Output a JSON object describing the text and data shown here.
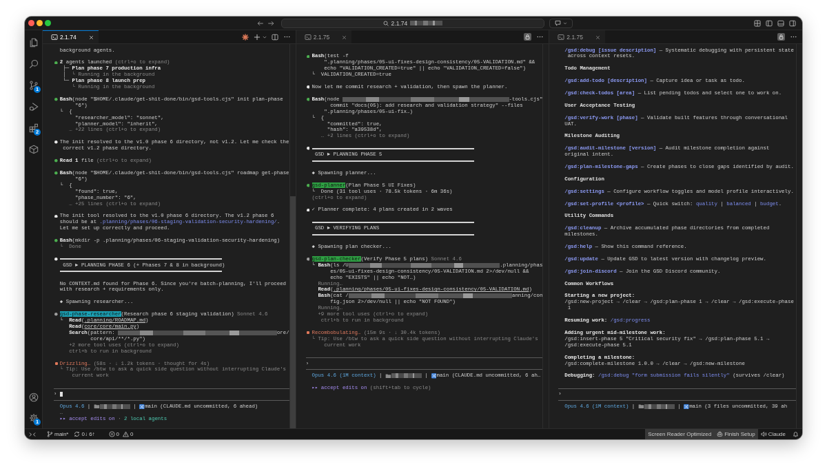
{
  "title_bar": {
    "command_center": {
      "text": "2.1.74",
      "redacted": true
    }
  },
  "activity_bar": {
    "top": [
      {
        "kind": "explorer"
      },
      {
        "kind": "search"
      },
      {
        "kind": "scm",
        "badge": "1"
      },
      {
        "kind": "debug"
      },
      {
        "kind": "extensions",
        "badge": "2"
      },
      {
        "kind": "containers"
      }
    ],
    "bottom": [
      {
        "kind": "account"
      },
      {
        "kind": "settings",
        "badge": "1"
      }
    ]
  },
  "panes": [
    {
      "tab": {
        "label": "2.1.74",
        "focused": true
      },
      "actions": [
        {
          "kind": "spark"
        },
        {
          "kind": "new"
        },
        {
          "kind": "dropdown"
        },
        {
          "kind": "split"
        },
        {
          "kind": "more"
        }
      ],
      "scroll_thumb": true,
      "blocks": [
        {
          "kind": "continuation",
          "paras": [
            {
              "lines": [
                [
                  "background agents."
                ]
              ]
            }
          ]
        },
        {
          "kind": "entry",
          "bullet": {
            "kind": "dot",
            "color": "#4caf50"
          },
          "paras": [
            {
              "lines": [
                [
                  {
                    "text": "2",
                    "kind": "bold"
                  },
                  " agents launched ",
                  {
                    "text": "(ctrl+o to expand)",
                    "kind": "dim"
                  }
                ]
              ]
            },
            {
              "lines": [
                [
                  " ├─ ",
                  {
                    "text": "Plan phase 7 production infra",
                    "kind": "bold"
                  }
                ],
                [
                  " │  ",
                  {
                    "text": "└ Running in the background",
                    "kind": "dim"
                  }
                ],
                [
                  " └─ ",
                  {
                    "text": "Plan phase 8 launch prep",
                    "kind": "bold"
                  }
                ],
                [
                  {
                    "text": "    └ Running in the background",
                    "kind": "dim"
                  }
                ]
              ]
            }
          ]
        },
        {
          "kind": "entry",
          "bullet": {
            "kind": "dot",
            "color": "#4caf50"
          },
          "paras": [
            {
              "lines": [
                [
                  {
                    "text": "Bash",
                    "kind": "bold"
                  },
                  "(node \"$HOME/.claude/get-shit-done/bin/gsd-tools.cjs\" init plan-phase"
                ],
                [
                  "     \"6\")"
                ]
              ]
            },
            {
              "lines": [
                [
                  "└  {"
                ],
                [
                  "     \"researcher_model\": \"sonnet\","
                ],
                [
                  "     \"planner_model\": \"inherit\","
                ],
                [
                  {
                    "text": "   … +22 lines (ctrl+o to expand)",
                    "kind": "dim"
                  }
                ]
              ]
            }
          ]
        },
        {
          "kind": "entry",
          "bullet": {
            "kind": "dot",
            "color": "#e6e6e6"
          },
          "paras": [
            {
              "lines": [
                [
                  "The init resolved to the v1.0 phase 6 directory, not v1.2. Let me check the"
                ],
                [
                  " correct v1.2 phase directory."
                ]
              ]
            }
          ]
        },
        {
          "kind": "entry",
          "bullet": {
            "kind": "dot",
            "color": "#4caf50"
          },
          "paras": [
            {
              "lines": [
                [
                  {
                    "text": "Read 1",
                    "kind": "bold"
                  },
                  " file ",
                  {
                    "text": "(ctrl+o to expand)",
                    "kind": "dim"
                  }
                ]
              ]
            }
          ]
        },
        {
          "kind": "entry",
          "bullet": {
            "kind": "dot",
            "color": "#4caf50"
          },
          "paras": [
            {
              "lines": [
                [
                  {
                    "text": "Bash",
                    "kind": "bold"
                  },
                  "(node \"$HOME/.claude/get-shit-done/bin/gsd-tools.cjs\" roadmap get-phase"
                ],
                [
                  "     \"6\")"
                ]
              ]
            },
            {
              "lines": [
                [
                  "└  {"
                ],
                [
                  "     \"found\": true,"
                ],
                [
                  "     \"phase_number\": \"6\","
                ],
                [
                  {
                    "text": "   … +25 lines (ctrl+o to expand)",
                    "kind": "dim"
                  }
                ]
              ]
            }
          ]
        },
        {
          "kind": "entry",
          "bullet": {
            "kind": "dot",
            "color": "#e6e6e6"
          },
          "paras": [
            {
              "lines": [
                [
                  "The init tool resolved to the v1.0 phase 6 directory. The v1.2 phase 6"
                ],
                [
                  "should be at ",
                  {
                    "text": ".planning/phases/06-staging-validation-security-hardening/",
                    "kind": "link"
                  },
                  "."
                ],
                [
                  "Let me set up correctly and proceed."
                ]
              ]
            }
          ]
        },
        {
          "kind": "entry",
          "bullet": {
            "kind": "dot",
            "color": "#4caf50"
          },
          "paras": [
            {
              "lines": [
                [
                  {
                    "text": "Bash",
                    "kind": "bold"
                  },
                  "(mkdir -p .planning/phases/06-staging-validation-security-hardening)"
                ]
              ]
            },
            {
              "lines": [
                [
                  {
                    "text": "└  Done",
                    "kind": "dim"
                  }
                ]
              ]
            }
          ]
        },
        {
          "kind": "entry",
          "bullet": {
            "kind": "dot",
            "color": "#e6e6e6"
          },
          "paras": [
            {
              "kind": "banner",
              "lines": [
                [
                  "GSD ► PLANNING PHASE 6 (+ Phases 7 & 8 in background)"
                ]
              ]
            }
          ]
        },
        {
          "kind": "entry",
          "paras": [
            {
              "lines": [
                [
                  "No CONTEXT.md found for Phase 6. Since you're batch-planning, I'll proceed"
                ],
                [
                  "with research + requirements only."
                ]
              ]
            }
          ]
        },
        {
          "kind": "entry",
          "paras": [
            {
              "lines": [
                [
                  "◆ Spawning researcher..."
                ]
              ]
            }
          ]
        },
        {
          "kind": "entry",
          "bullet": {
            "kind": "dot",
            "color": "#9e9e9e"
          },
          "paras": [
            {
              "lines": [
                [
                  {
                    "text": "gsd-phase-researcher",
                    "kind": "agent",
                    "color": "#1ba1b5"
                  },
                  "(Research phase 6 staging validation) ",
                  {
                    "text": "Sonnet 4.6",
                    "kind": "dim"
                  }
                ]
              ]
            },
            {
              "lines": [
                [
                  "└  ",
                  {
                    "text": "Read",
                    "kind": "bold"
                  },
                  "(",
                  {
                    "text": ".planning/ROADMAP.md",
                    "kind": "path"
                  },
                  ")"
                ],
                [
                  {
                    "text": "   Read",
                    "kind": "bold"
                  },
                  "(",
                  {
                    "text": "core/core/main.py",
                    "kind": "path"
                  },
                  ")"
                ],
                [
                  {
                    "text": "   Search",
                    "kind": "bold"
                  },
                  "(pattern: ",
                  {
                    "kind": "redaction-fill"
                  },
                  "ore/"
                ],
                [
                  "          core/api/**/*.py\")"
                ],
                [
                  {
                    "text": "   +2 more tool uses (ctrl+o to expand)",
                    "kind": "dim"
                  }
                ],
                [
                  {
                    "text": "   ctrl+b to run in background",
                    "kind": "dim"
                  }
                ]
              ]
            }
          ]
        },
        {
          "kind": "entry",
          "bullet": {
            "kind": "spinner",
            "color": "#e0785a"
          },
          "paras": [
            {
              "lines": [
                [
                  {
                    "text": "Drizzling…",
                    "kind": "busy"
                  },
                  {
                    "text": " (58s · ↓ 1.2k tokens · thought for 4s)",
                    "kind": "dim"
                  }
                ]
              ]
            },
            {
              "lines": [
                [
                  {
                    "text": "└ Tip: Use /btw to ask a quick side question without interrupting Claude's",
                    "kind": "dim"
                  }
                ],
                [
                  {
                    "text": "    current work",
                    "kind": "dim"
                  }
                ]
              ]
            }
          ]
        }
      ],
      "input": {
        "prompt": "›",
        "cursor": true
      },
      "footer": [
        {
          "kind": "continuation",
          "paras": [
            {
              "lines": [
                [
                  {
                    "text": "Opus 4.6",
                    "kind": "model"
                  },
                  " | ",
                  {
                    "kind": "folder"
                  },
                  {
                    "kind": "redaction"
                  },
                  " | ",
                  {
                    "kind": "branch"
                  },
                  "main (CLAUDE.md uncommitted, 6 ahead)"
                ]
              ]
            },
            {
              "lines": [
                [
                  {
                    "text": "…",
                    "kind": "dim"
                  }
                ]
              ]
            },
            {
              "lines": [
                [
                  {
                    "text": "▸▸ accept edits on",
                    "kind": "mode"
                  },
                  {
                    "text": " · ",
                    "kind": "dim"
                  },
                  {
                    "text": "2 local agents",
                    "kind": "ok"
                  }
                ]
              ]
            }
          ]
        }
      ]
    },
    {
      "tab": {
        "label": "2.1.75",
        "focused": false
      },
      "actions": [
        {
          "kind": "lock"
        },
        {
          "kind": "more"
        }
      ],
      "locked": true,
      "blocks": [
        {
          "kind": "entry",
          "bullet": {
            "kind": "dot",
            "color": "#4caf50"
          },
          "paras": [
            {
              "lines": [
                [
                  {
                    "text": "Bash",
                    "kind": "bold"
                  },
                  "(test -f"
                ],
                [
                  "    \".planning/phases/05-ui-fixes-design-consistency/05-VALIDATION.md\" &&"
                ],
                [
                  "    echo \"VALIDATION_CREATED=true\" || echo \"VALIDATION_CREATED=false\")"
                ]
              ]
            },
            {
              "lines": [
                [
                  "└  VALIDATION_CREATED=true"
                ]
              ]
            }
          ]
        },
        {
          "kind": "entry",
          "bullet": {
            "kind": "dot",
            "color": "#e6e6e6"
          },
          "paras": [
            {
              "lines": [
                [
                  "Now let me commit research + validation, then spawn the planner."
                ]
              ]
            }
          ]
        },
        {
          "kind": "entry",
          "bullet": {
            "kind": "dot",
            "color": "#4caf50"
          },
          "paras": [
            {
              "lines": [
                [
                  {
                    "text": "Bash",
                    "kind": "bold"
                  },
                  "(node ",
                  {
                    "kind": "redaction-fill"
                  },
                  "-tools.cjs\""
                ],
                [
                  "      commit \"docs(05): add research and validation strategy\" --files"
                ],
                [
                  "    \".planning/phases/05-ui-fix…)"
                ]
              ]
            },
            {
              "lines": [
                [
                  "└  {"
                ],
                [
                  "     \"committed\": true,"
                ],
                [
                  "     \"hash\": \"a39538d\","
                ],
                [
                  {
                    "text": "   … +2 lines (ctrl+o to expand)",
                    "kind": "dim"
                  }
                ]
              ]
            }
          ]
        },
        {
          "kind": "entry",
          "bullet": {
            "kind": "dot",
            "color": "#e6e6e6"
          },
          "paras": [
            {
              "kind": "banner",
              "lines": [
                [
                  "GSD ► PLANNING PHASE 5"
                ]
              ]
            }
          ]
        },
        {
          "kind": "entry",
          "paras": [
            {
              "lines": [
                [
                  "◆ Spawning planner..."
                ]
              ]
            }
          ]
        },
        {
          "kind": "entry",
          "bullet": {
            "kind": "dot",
            "color": "#4caf50"
          },
          "paras": [
            {
              "lines": [
                [
                  {
                    "text": "gsd-planner",
                    "kind": "agent",
                    "color": "#2ea043"
                  },
                  "(Plan Phase 5 UI Fixes)"
                ]
              ]
            },
            {
              "lines": [
                [
                  "└  Done (31 tool uses · 78.5k tokens · 6m 36s)"
                ]
              ]
            },
            {
              "lines": [
                [
                  {
                    "text": "(ctrl+o to expand)",
                    "kind": "dim"
                  }
                ]
              ]
            }
          ]
        },
        {
          "kind": "entry",
          "bullet": {
            "kind": "dot",
            "color": "#e6e6e6"
          },
          "paras": [
            {
              "lines": [
                [
                  "✓ Planner complete: 4 plans created in 2 waves"
                ]
              ]
            }
          ]
        },
        {
          "kind": "entry",
          "paras": [
            {
              "kind": "banner",
              "lines": [
                [
                  "GSD ► VERIFYING PLANS"
                ]
              ]
            }
          ]
        },
        {
          "kind": "entry",
          "paras": [
            {
              "lines": [
                [
                  "◆ Spawning plan checker..."
                ]
              ]
            }
          ]
        },
        {
          "kind": "entry",
          "bullet": {
            "kind": "dot",
            "color": "#9e9e9e"
          },
          "paras": [
            {
              "lines": [
                [
                  {
                    "text": "gsd-plan-checker",
                    "kind": "agent",
                    "color": "#2ea043"
                  },
                  "(Verify Phase 5 plans) ",
                  {
                    "text": "Sonnet 4.6",
                    "kind": "dim"
                  }
                ]
              ]
            },
            {
              "lines": [
                [
                  "└ ",
                  {
                    "text": "Bash",
                    "kind": "bold"
                  },
                  "(ls /U",
                  {
                    "kind": "redaction-fill"
                  },
                  ".planning/phas"
                ],
                [
                  "      es/05-ui-fixes-design-consistency/05-VALIDATION.md 2>/dev/null &&"
                ],
                [
                  "      echo \"EXISTS\" || echo \"NOT…)"
                ],
                [
                  {
                    "text": "  Running…",
                    "kind": "dim"
                  }
                ],
                [
                  {
                    "text": "  Read",
                    "kind": "bold"
                  },
                  "(",
                  {
                    "text": ".planning/phases/05-ui-fixes-design-consistency/05-VALIDATION.md",
                    "kind": "path"
                  },
                  ")"
                ],
                [
                  {
                    "text": "  Bash",
                    "kind": "bold"
                  },
                  "(cat /",
                  {
                    "kind": "redaction-fill"
                  },
                  "anning/con"
                ],
                [
                  "      fig.json 2>/dev/null || echo \"NOT FOUND\")"
                ],
                [
                  {
                    "text": "  Running…",
                    "kind": "dim"
                  }
                ],
                [
                  {
                    "text": "  +9 more tool uses (ctrl+o to expand)",
                    "kind": "dim"
                  }
                ],
                [
                  {
                    "text": "   ctrl+b to run in background",
                    "kind": "dim"
                  }
                ]
              ]
            }
          ]
        },
        {
          "kind": "entry",
          "bullet": {
            "kind": "spinner",
            "color": "#e0785a"
          },
          "paras": [
            {
              "lines": [
                [
                  {
                    "text": "Recombobulating…",
                    "kind": "busy"
                  },
                  {
                    "text": " (15m 9s · ↓ 30.4k tokens)",
                    "kind": "dim"
                  }
                ]
              ]
            },
            {
              "lines": [
                [
                  {
                    "text": "└ Tip: Use /btw to ask a quick side question without interrupting Claude's",
                    "kind": "dim"
                  }
                ],
                [
                  {
                    "text": "    current work",
                    "kind": "dim"
                  }
                ]
              ]
            }
          ]
        }
      ],
      "input": {
        "prompt": "›",
        "cursor": false
      },
      "footer": [
        {
          "kind": "continuation",
          "paras": [
            {
              "lines": [
                [
                  {
                    "text": "Opus 4.6 (1M context)",
                    "kind": "model"
                  },
                  " | ",
                  {
                    "kind": "folder"
                  },
                  {
                    "kind": "redaction"
                  },
                  " | ",
                  {
                    "kind": "branch"
                  },
                  "main (CLAUDE.md uncommitted, 6 ah…"
                ]
              ]
            }
          ]
        },
        {
          "kind": "entry",
          "paras": [
            {
              "lines": [
                [
                  {
                    "text": "▸▸ accept edits on",
                    "kind": "mode"
                  },
                  {
                    "text": " (shift+tab to cycle)",
                    "kind": "dim"
                  }
                ]
              ]
            }
          ]
        }
      ]
    },
    {
      "tab": {
        "label": "2.1.75",
        "focused": false
      },
      "actions": [
        {
          "kind": "lock"
        },
        {
          "kind": "more"
        }
      ],
      "locked": true,
      "blocks": [
        {
          "kind": "continuation",
          "paras": [
            {
              "lines": [
                [
                  {
                    "text": "/gsd:debug [issue description]",
                    "kind": "cmd"
                  },
                  " — Systematic debugging with persistent state"
                ],
                [
                  " across context resets."
                ]
              ]
            }
          ]
        },
        {
          "kind": "entry",
          "paras": [
            {
              "kind": "heading",
              "lines": [
                [
                  "Todo Management"
                ]
              ]
            }
          ]
        },
        {
          "kind": "entry",
          "paras": [
            {
              "lines": [
                [
                  {
                    "text": "/gsd:add-todo [description]",
                    "kind": "cmd"
                  },
                  " — Capture idea or task as todo."
                ]
              ]
            }
          ]
        },
        {
          "kind": "entry",
          "paras": [
            {
              "lines": [
                [
                  {
                    "text": "/gsd:check-todos [area]",
                    "kind": "cmd"
                  },
                  " — List pending todos and select one to work on."
                ]
              ]
            }
          ]
        },
        {
          "kind": "entry",
          "paras": [
            {
              "kind": "heading",
              "lines": [
                [
                  "User Acceptance Testing"
                ]
              ]
            }
          ]
        },
        {
          "kind": "entry",
          "paras": [
            {
              "lines": [
                [
                  {
                    "text": "/gsd:verify-work [phase]",
                    "kind": "cmd"
                  },
                  " — Validate built features through conversational"
                ],
                [
                  "UAT."
                ]
              ]
            }
          ]
        },
        {
          "kind": "entry",
          "paras": [
            {
              "kind": "heading",
              "lines": [
                [
                  "Milestone Auditing"
                ]
              ]
            }
          ]
        },
        {
          "kind": "entry",
          "paras": [
            {
              "lines": [
                [
                  {
                    "text": "/gsd:audit-milestone [version]",
                    "kind": "cmd"
                  },
                  " — Audit milestone completion against"
                ],
                [
                  "original intent."
                ]
              ]
            }
          ]
        },
        {
          "kind": "entry",
          "paras": [
            {
              "lines": [
                [
                  {
                    "text": "/gsd:plan-milestone-gaps",
                    "kind": "cmd"
                  },
                  " — Create phases to close gaps identified by audit."
                ]
              ]
            }
          ]
        },
        {
          "kind": "entry",
          "paras": [
            {
              "kind": "heading",
              "lines": [
                [
                  "Configuration"
                ]
              ]
            }
          ]
        },
        {
          "kind": "entry",
          "paras": [
            {
              "lines": [
                [
                  {
                    "text": "/gsd:settings",
                    "kind": "cmd"
                  },
                  " — Configure workflow toggles and model profile interactively."
                ]
              ]
            }
          ]
        },
        {
          "kind": "entry",
          "paras": [
            {
              "lines": [
                [
                  {
                    "text": "/gsd:set-profile <profile>",
                    "kind": "cmd"
                  },
                  " — Quick switch: ",
                  {
                    "text": "quality",
                    "kind": "link"
                  },
                  " | ",
                  {
                    "text": "balanced",
                    "kind": "link"
                  },
                  " | ",
                  {
                    "text": "budget",
                    "kind": "link"
                  },
                  "."
                ]
              ]
            }
          ]
        },
        {
          "kind": "entry",
          "paras": [
            {
              "kind": "heading",
              "lines": [
                [
                  "Utility Commands"
                ]
              ]
            }
          ]
        },
        {
          "kind": "entry",
          "paras": [
            {
              "lines": [
                [
                  {
                    "text": "/gsd:cleanup",
                    "kind": "cmd"
                  },
                  " — Archive accumulated phase directories from completed"
                ],
                [
                  "milestones."
                ]
              ]
            }
          ]
        },
        {
          "kind": "entry",
          "paras": [
            {
              "lines": [
                [
                  {
                    "text": "/gsd:help",
                    "kind": "cmd"
                  },
                  " — Show this command reference."
                ]
              ]
            }
          ]
        },
        {
          "kind": "entry",
          "paras": [
            {
              "lines": [
                [
                  {
                    "text": "/gsd:update",
                    "kind": "cmd"
                  },
                  " — Update GSD to latest version with changelog preview."
                ]
              ]
            }
          ]
        },
        {
          "kind": "entry",
          "paras": [
            {
              "lines": [
                [
                  {
                    "text": "/gsd:join-discord",
                    "kind": "cmd"
                  },
                  " — Join the GSD Discord community."
                ]
              ]
            }
          ]
        },
        {
          "kind": "entry",
          "paras": [
            {
              "kind": "heading",
              "lines": [
                [
                  "Common Workflows"
                ]
              ]
            }
          ]
        },
        {
          "kind": "entry",
          "paras": [
            {
              "lines": [
                [
                  {
                    "text": "Starting a new project:",
                    "kind": "bold"
                  }
                ],
                [
                  "/gsd:new-project → /clear → /gsd:plan-phase 1 → /clear → /gsd:execute-phase"
                ],
                [
                  " 1"
                ]
              ]
            }
          ]
        },
        {
          "kind": "entry",
          "paras": [
            {
              "lines": [
                [
                  {
                    "text": "Resuming work: ",
                    "kind": "bold"
                  },
                  {
                    "text": "/gsd:progress",
                    "kind": "link"
                  }
                ]
              ]
            }
          ]
        },
        {
          "kind": "entry",
          "paras": [
            {
              "lines": [
                [
                  {
                    "text": "Adding urgent mid-milestone work:",
                    "kind": "bold"
                  }
                ],
                [
                  "/gsd:insert-phase 5 \"Critical security fix\" → /gsd:plan-phase 5.1 →"
                ],
                [
                  "/gsd:execute-phase 5.1"
                ]
              ]
            }
          ]
        },
        {
          "kind": "entry",
          "paras": [
            {
              "lines": [
                [
                  {
                    "text": "Completing a milestone:",
                    "kind": "bold"
                  }
                ],
                [
                  "/gsd:complete-milestone 1.0.0 → /clear → /gsd:new-milestone"
                ]
              ]
            }
          ]
        },
        {
          "kind": "entry",
          "paras": [
            {
              "lines": [
                [
                  {
                    "text": "Debugging: ",
                    "kind": "bold"
                  },
                  {
                    "text": "/gsd:debug \"form submission fails silently\"",
                    "kind": "link"
                  },
                  " (survives /clear)"
                ]
              ]
            }
          ]
        }
      ],
      "input": {
        "prompt": "›",
        "cursor": false
      },
      "footer": [
        {
          "kind": "continuation",
          "paras": [
            {
              "lines": [
                [
                  {
                    "text": "Opus 4.6 (1M context)",
                    "kind": "model"
                  },
                  " | ",
                  {
                    "kind": "folder"
                  },
                  {
                    "kind": "redaction"
                  },
                  " | ",
                  {
                    "kind": "branch"
                  },
                  "main (3 files uncommitted, 39 ah"
                ]
              ]
            }
          ]
        }
      ]
    }
  ],
  "status_bar": {
    "branch": "main*",
    "sync": "0↓ 6↑",
    "errors": "0",
    "warnings": "0",
    "items": [
      {
        "label": "Screen Reader Optimized",
        "kind": "mode",
        "highlighted": true
      },
      {
        "label": "Finish Setup",
        "kind": "setup",
        "highlighted": true
      },
      {
        "label": "Claude",
        "kind": "assistant",
        "highlighted": false
      }
    ]
  }
}
